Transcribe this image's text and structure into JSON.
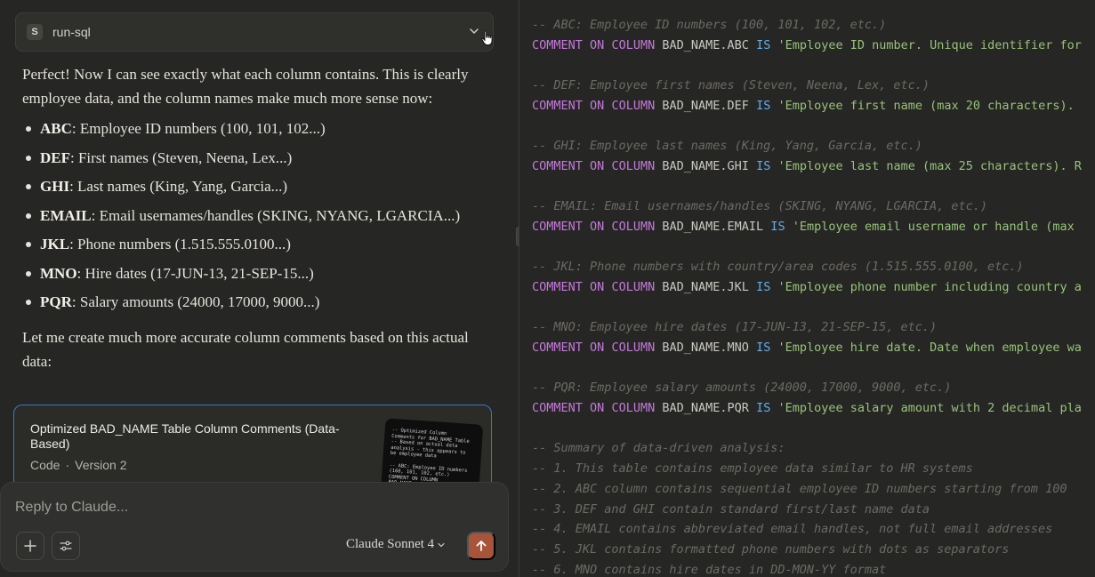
{
  "tool": {
    "badge": "S",
    "name": "run-sql"
  },
  "message": {
    "intro": "Perfect! Now I can see exactly what each column contains. This is clearly employee data, and the column names make much more sense now:",
    "columns": [
      {
        "name": "ABC",
        "desc": ": Employee ID numbers (100, 101, 102...)"
      },
      {
        "name": "DEF",
        "desc": ": First names (Steven, Neena, Lex...)"
      },
      {
        "name": "GHI",
        "desc": ": Last names (King, Yang, Garcia...)"
      },
      {
        "name": "EMAIL",
        "desc": ": Email usernames/handles (SKING, NYANG, LGARCIA...)"
      },
      {
        "name": "JKL",
        "desc": ": Phone numbers (1.515.555.0100...)"
      },
      {
        "name": "MNO",
        "desc": ": Hire dates (17-JUN-13, 21-SEP-15...)"
      },
      {
        "name": "PQR",
        "desc": ": Salary amounts (24000, 17000, 9000...)"
      }
    ],
    "outro": "Let me create much more accurate column comments based on this actual data:"
  },
  "artifact": {
    "title": "Optimized BAD_NAME Table Column Comments (Data-Based)",
    "kind": "Code",
    "separator": "·",
    "version": "Version 2",
    "thumb_text": "-- Optimized Column\nComments for BAD_NAME Table\n-- Based on actual data\nanalysis - this appears to\nbe employee data\n\n-- ABC: Employee ID numbers\n(100, 101, 102, etc.)\nCOMMENT ON COLUMN\nBAD_NAME.ABC IS 'Employee\nID number. Unique"
  },
  "composer": {
    "placeholder": "Reply to Claude...",
    "model": "Claude Sonnet 4"
  },
  "code": {
    "keyword_comment": "COMMENT",
    "keyword_on": "ON",
    "keyword_column": "COLUMN",
    "keyword_is": "IS",
    "lines": [
      {
        "type": "comment",
        "text": "-- ABC: Employee ID numbers (100, 101, 102, etc.)"
      },
      {
        "type": "stmt",
        "target": "BAD_NAME.ABC",
        "value": "'Employee ID number. Unique identifier for"
      },
      {
        "type": "blank"
      },
      {
        "type": "comment",
        "text": "-- DEF: Employee first names (Steven, Neena, Lex, etc.)"
      },
      {
        "type": "stmt",
        "target": "BAD_NAME.DEF",
        "value": "'Employee first name (max 20 characters)."
      },
      {
        "type": "blank"
      },
      {
        "type": "comment",
        "text": "-- GHI: Employee last names (King, Yang, Garcia, etc.)"
      },
      {
        "type": "stmt",
        "target": "BAD_NAME.GHI",
        "value": "'Employee last name (max 25 characters). R"
      },
      {
        "type": "blank"
      },
      {
        "type": "comment",
        "text": "-- EMAIL: Email usernames/handles (SKING, NYANG, LGARCIA, etc.)"
      },
      {
        "type": "stmt",
        "target": "BAD_NAME.EMAIL",
        "value": "'Employee email username or handle (max"
      },
      {
        "type": "blank"
      },
      {
        "type": "comment",
        "text": "-- JKL: Phone numbers with country/area codes (1.515.555.0100, etc.)"
      },
      {
        "type": "stmt",
        "target": "BAD_NAME.JKL",
        "value": "'Employee phone number including country a"
      },
      {
        "type": "blank"
      },
      {
        "type": "comment",
        "text": "-- MNO: Employee hire dates (17-JUN-13, 21-SEP-15, etc.)"
      },
      {
        "type": "stmt",
        "target": "BAD_NAME.MNO",
        "value": "'Employee hire date. Date when employee wa"
      },
      {
        "type": "blank"
      },
      {
        "type": "comment",
        "text": "-- PQR: Employee salary amounts (24000, 17000, 9000, etc.)"
      },
      {
        "type": "stmt",
        "target": "BAD_NAME.PQR",
        "value": "'Employee salary amount with 2 decimal pla"
      },
      {
        "type": "blank"
      },
      {
        "type": "comment",
        "text": "-- Summary of data-driven analysis:"
      },
      {
        "type": "comment",
        "text": "-- 1. This table contains employee data similar to HR systems"
      },
      {
        "type": "comment",
        "text": "-- 2. ABC column contains sequential employee ID numbers starting from 100"
      },
      {
        "type": "comment",
        "text": "-- 3. DEF and GHI contain standard first/last name data"
      },
      {
        "type": "comment",
        "text": "-- 4. EMAIL contains abbreviated email handles, not full email addresses"
      },
      {
        "type": "comment",
        "text": "-- 5. JKL contains formatted phone numbers with dots as separators"
      },
      {
        "type": "comment",
        "text": "-- 6. MNO contains hire dates in DD-MON-YY format"
      }
    ]
  }
}
